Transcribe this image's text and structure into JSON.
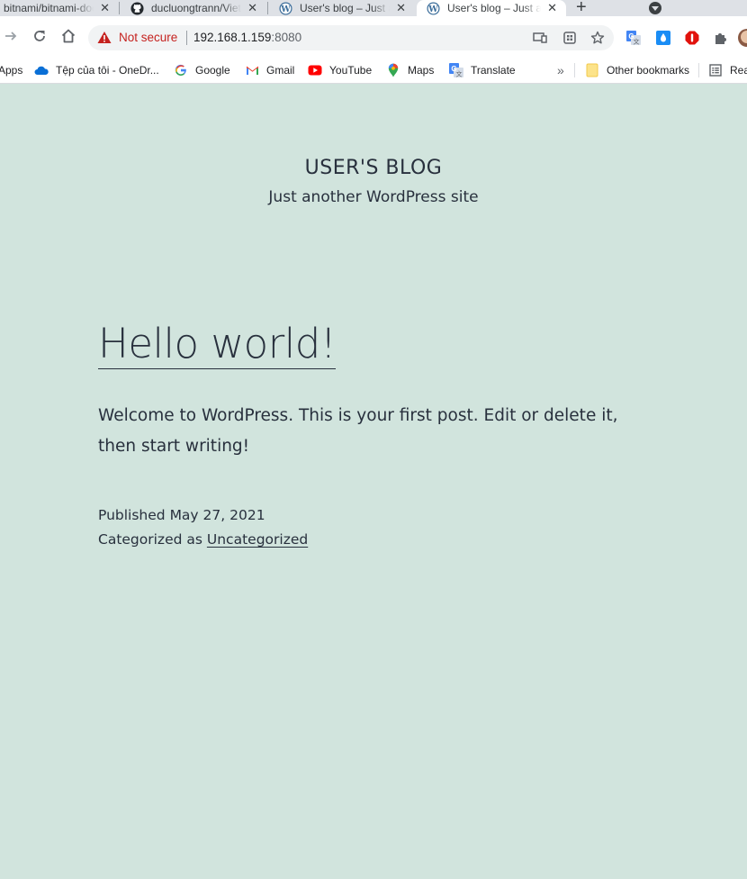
{
  "tabs": [
    {
      "title": "bitnami/bitnami-docker-wordpress",
      "favicon": "none",
      "active": false
    },
    {
      "title": "ducluongtrann/Vietnam",
      "favicon": "github-icon",
      "active": false
    },
    {
      "title": "User's blog – Just another WordPress site",
      "favicon": "wordpress-icon",
      "active": false
    },
    {
      "title": "User's blog – Just another WordPress site",
      "favicon": "wordpress-icon",
      "active": true
    }
  ],
  "toolbar": {
    "security_label": "Not secure",
    "url_host": "192.168.1.159",
    "url_port": ":8080"
  },
  "bookmarks": [
    {
      "label": "Apps",
      "icon": "apps-icon"
    },
    {
      "label": "Tệp của tôi - OneDr...",
      "icon": "onedrive-icon"
    },
    {
      "label": "Google",
      "icon": "google-icon"
    },
    {
      "label": "Gmail",
      "icon": "gmail-icon"
    },
    {
      "label": "YouTube",
      "icon": "youtube-icon"
    },
    {
      "label": "Maps",
      "icon": "maps-icon"
    },
    {
      "label": "Translate",
      "icon": "translate-icon"
    }
  ],
  "bookmarks_overflow": "»",
  "other_bookmarks": "Other bookmarks",
  "reading_list": "Rea",
  "page": {
    "site_title": "USER'S BLOG",
    "site_description": "Just another WordPress site",
    "post_title": "Hello world!",
    "post_body": "Welcome to WordPress. This is your first post. Edit or delete it, then start writing!",
    "published_prefix": "Published",
    "published_date": "May 27, 2021",
    "categorized_prefix": "Categorized as",
    "category": "Uncategorized"
  },
  "colors": {
    "page_background": "#d1e4dd",
    "text": "#28303d",
    "not_secure": "#c5221f",
    "chrome_tabstrip": "#dee1e6"
  }
}
